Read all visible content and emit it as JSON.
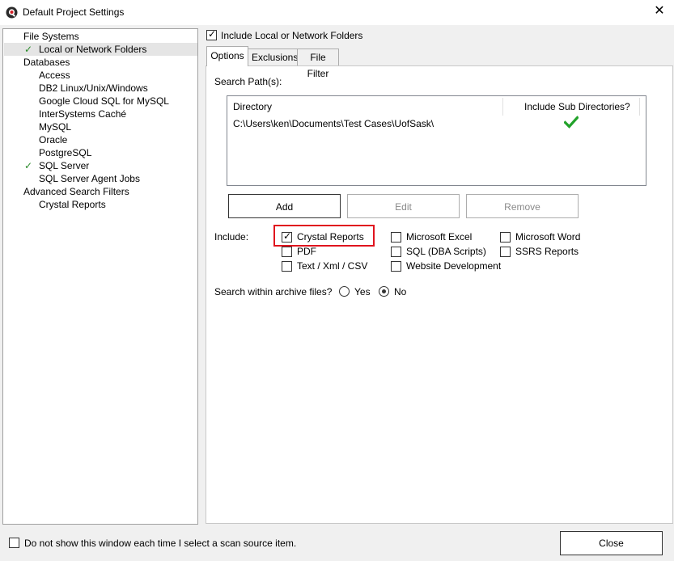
{
  "window": {
    "title": "Default Project Settings",
    "close_glyph": "✕"
  },
  "tree": {
    "items": [
      {
        "label": "File Systems",
        "checked": false
      },
      {
        "label": "Local or Network Folders",
        "checked": true
      },
      {
        "label": "Databases",
        "checked": false
      },
      {
        "label": "Access",
        "checked": false
      },
      {
        "label": "DB2 Linux/Unix/Windows",
        "checked": false
      },
      {
        "label": "Google Cloud SQL for MySQL",
        "checked": false
      },
      {
        "label": "InterSystems Caché",
        "checked": false
      },
      {
        "label": "MySQL",
        "checked": false
      },
      {
        "label": "Oracle",
        "checked": false
      },
      {
        "label": "PostgreSQL",
        "checked": false
      },
      {
        "label": "SQL Server",
        "checked": true
      },
      {
        "label": "SQL Server Agent Jobs",
        "checked": false
      },
      {
        "label": "Advanced Search Filters",
        "checked": false
      },
      {
        "label": "Crystal Reports",
        "checked": false
      }
    ],
    "check_glyph": "✓"
  },
  "include_local": {
    "label": "Include Local or Network Folders",
    "checked": true
  },
  "tabs": [
    {
      "label": "Options"
    },
    {
      "label": "Exclusions"
    },
    {
      "label": "File Filter"
    }
  ],
  "search_paths": {
    "label": "Search Path(s):",
    "columns": {
      "directory": "Directory",
      "include_sub": "Include Sub Directories?"
    },
    "rows": [
      {
        "directory": "C:\\Users\\ken\\Documents\\Test Cases\\UofSask\\",
        "include_sub": true
      }
    ]
  },
  "buttons": {
    "add": "Add",
    "edit": "Edit",
    "remove": "Remove",
    "close": "Close"
  },
  "include": {
    "label": "Include:",
    "options": {
      "crystal_reports": {
        "label": "Crystal Reports",
        "checked": true
      },
      "pdf": {
        "label": "PDF",
        "checked": false
      },
      "text_xml_csv": {
        "label": "Text / Xml / CSV",
        "checked": false
      },
      "microsoft_excel": {
        "label": "Microsoft Excel",
        "checked": false
      },
      "sql_dba_scripts": {
        "label": "SQL (DBA Scripts)",
        "checked": false
      },
      "website_development": {
        "label": "Website Development",
        "checked": false
      },
      "microsoft_word": {
        "label": "Microsoft Word",
        "checked": false
      },
      "ssrs_reports": {
        "label": "SSRS Reports",
        "checked": false
      }
    }
  },
  "archive": {
    "label": "Search within archive files?",
    "yes": "Yes",
    "no": "No",
    "selected": "No"
  },
  "footer": {
    "dont_show_label": "Do not show this window each time I select a scan source item.",
    "checked": false
  },
  "colors": {
    "check_green": "#2a8a2a",
    "highlight_red": "#e0141e"
  }
}
